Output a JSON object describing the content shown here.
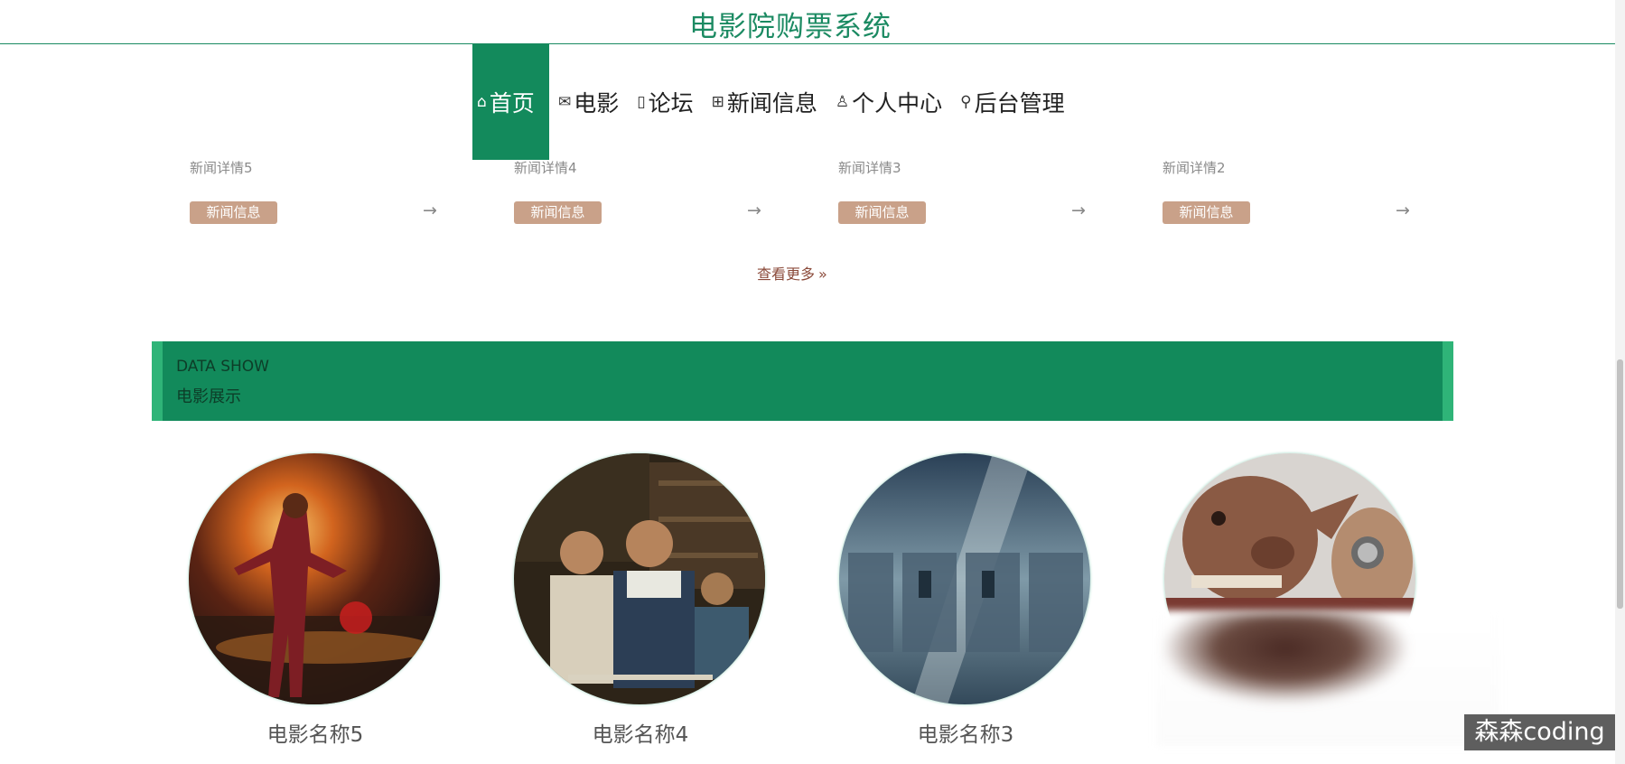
{
  "site_title": "电影院购票系统",
  "nav": [
    {
      "icon": "⌂",
      "label": "首页",
      "active": true
    },
    {
      "icon": "✉",
      "label": "电影"
    },
    {
      "icon": "▯",
      "label": "论坛"
    },
    {
      "icon": "⊞",
      "label": "新闻信息"
    },
    {
      "icon": "♙",
      "label": "个人中心"
    },
    {
      "icon": "⚲",
      "label": "后台管理"
    }
  ],
  "news": [
    {
      "title": "新闻详情5",
      "tag": "新闻信息",
      "arrow": "→"
    },
    {
      "title": "新闻详情4",
      "tag": "新闻信息",
      "arrow": "→"
    },
    {
      "title": "新闻详情3",
      "tag": "新闻信息",
      "arrow": "→"
    },
    {
      "title": "新闻详情2",
      "tag": "新闻信息",
      "arrow": "→"
    }
  ],
  "more_link": "查看更多",
  "more_icon": "»",
  "section": {
    "en": "DATA SHOW",
    "cn": "电影展示"
  },
  "movies": [
    {
      "name": "电影名称5"
    },
    {
      "name": "电影名称4"
    },
    {
      "name": "电影名称3"
    },
    {
      "name": ""
    }
  ],
  "watermark": "森森coding",
  "colors": {
    "accent": "#138a5c",
    "tag": "#c9a189",
    "more": "#8b4a3a"
  }
}
